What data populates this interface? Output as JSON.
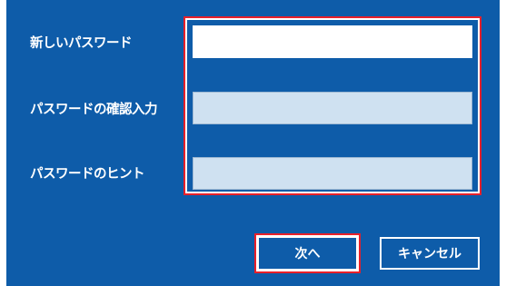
{
  "dialog": {
    "fields": [
      {
        "label": "新しいパスワード",
        "value": "",
        "state": "focused"
      },
      {
        "label": "パスワードの確認入力",
        "value": ""
      },
      {
        "label": "パスワードのヒント",
        "value": ""
      }
    ],
    "buttons": {
      "next_label": "次へ",
      "cancel_label": "キャンセル"
    },
    "colors": {
      "background": "#0e5ca9",
      "highlight": "#e8202a",
      "field_inactive": "#cfe1f1",
      "text": "#ffffff"
    }
  }
}
